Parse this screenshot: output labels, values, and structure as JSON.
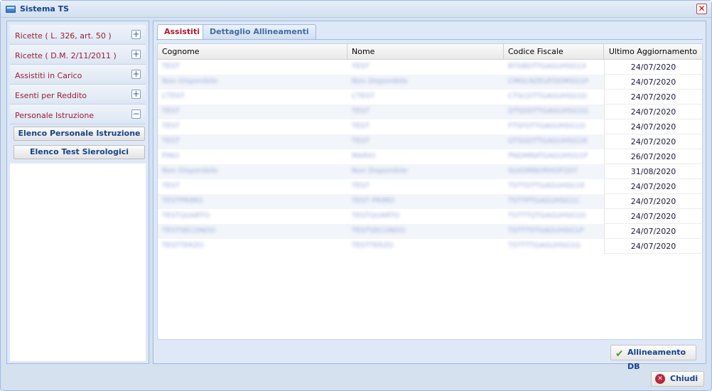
{
  "window": {
    "title": "Sistema TS",
    "close_glyph": "✕"
  },
  "sidebar": {
    "items": [
      {
        "label": "Ricette ( L. 326, art. 50 )",
        "toggle": "+"
      },
      {
        "label": "Ricette ( D.M. 2/11/2011 )",
        "toggle": "+"
      },
      {
        "label": "Assistiti in Carico",
        "toggle": "+"
      },
      {
        "label": "Esenti per Reddito",
        "toggle": "+"
      },
      {
        "label": "Personale Istruzione",
        "toggle": "−"
      }
    ],
    "sub_buttons": [
      "Elenco Personale Istruzione",
      "Elenco Test Sierologici"
    ]
  },
  "tabs": [
    {
      "label": "Assistiti",
      "active": true
    },
    {
      "label": "Dettaglio Allineamenti",
      "active": false
    }
  ],
  "table": {
    "columns": [
      "Cognome",
      "Nome",
      "Codice Fiscale",
      "Ultimo Aggiornamento"
    ],
    "rows": [
      {
        "cognome": "TEST",
        "nome": "TEST",
        "cf": "BTSBDTTGAGUHSG1X",
        "date": "24/07/2020"
      },
      {
        "cognome": "Non Disponibile",
        "nome": "Non Disponibile",
        "cf": "CMGLNZEUFDDMSG1P",
        "date": "24/07/2020"
      },
      {
        "cognome": "CTEST",
        "nome": "CTEST",
        "cf": "CTSCDTTGAGUHSG1D",
        "date": "24/07/2020"
      },
      {
        "cognome": "TEST",
        "nome": "TEST",
        "cf": "DTSDDTTGAGUHSG1G",
        "date": "24/07/2020"
      },
      {
        "cognome": "TEST",
        "nome": "TEST",
        "cf": "FTSFDTTGAGUHSG1D",
        "date": "24/07/2020"
      },
      {
        "cognome": "TEST",
        "nome": "TEST",
        "cf": "GTSGDTTGAGUHSG1R",
        "date": "24/07/2020"
      },
      {
        "cognome": "PINO",
        "nome": "MARIO",
        "cf": "PNDMRATGAGUHSG1P",
        "date": "26/07/2020"
      },
      {
        "cognome": "Non Disponibile",
        "nome": "Non Disponibile",
        "cf": "SLVGMNDRHOP2D7",
        "date": "31/08/2020"
      },
      {
        "cognome": "TEST",
        "nome": "TEST",
        "cf": "TSTTDTTGAGUHSG1E",
        "date": "24/07/2020"
      },
      {
        "cognome": "TESTPRIMO",
        "nome": "TEST PRIMO",
        "cf": "TSTTPTGAGUHSG1C",
        "date": "24/07/2020"
      },
      {
        "cognome": "TESTQUARTO",
        "nome": "TESTQUARTO",
        "cf": "TSTTTQTGAGUHSG1D",
        "date": "24/07/2020"
      },
      {
        "cognome": "TESTSECONDO",
        "nome": "TESTSECONDO",
        "cf": "TSTTTSTGAGUHSG1P",
        "date": "24/07/2020"
      },
      {
        "cognome": "TESTTERZO",
        "nome": "TESTTERZO",
        "cf": "TSTTTTGAGUHSG1G",
        "date": "24/07/2020"
      }
    ]
  },
  "actions": {
    "align_label": "Allineamento DB",
    "close_label": "Chiudi",
    "check_glyph": "✔",
    "x_glyph": "✕"
  },
  "icons": [
    "window-icon",
    "close-icon",
    "plus-icon",
    "minus-icon",
    "check-icon",
    "cancel-icon"
  ]
}
